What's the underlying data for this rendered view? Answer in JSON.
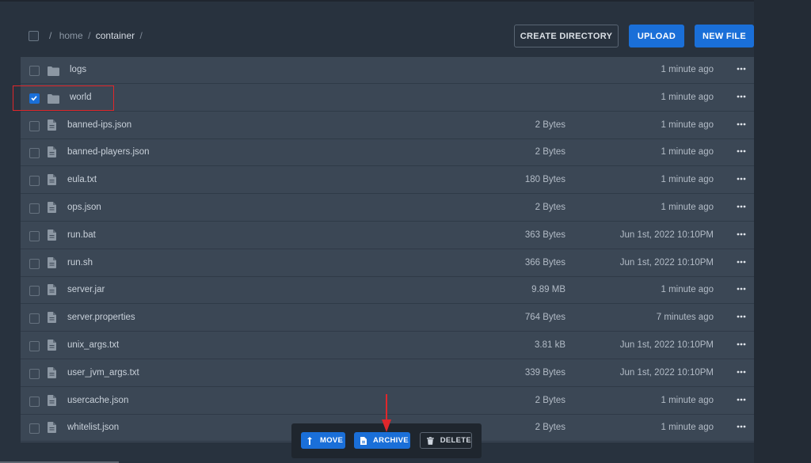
{
  "breadcrumb": {
    "root": "/",
    "home": "home",
    "sep1": "/",
    "current": "container",
    "sep2": "/"
  },
  "buttons": {
    "create_directory": "CREATE DIRECTORY",
    "upload": "UPLOAD",
    "new_file": "NEW FILE"
  },
  "files": [
    {
      "name": "logs",
      "type": "folder",
      "size": "",
      "modified": "1 minute ago",
      "checked": false
    },
    {
      "name": "world",
      "type": "folder",
      "size": "",
      "modified": "1 minute ago",
      "checked": true
    },
    {
      "name": "banned-ips.json",
      "type": "file",
      "size": "2 Bytes",
      "modified": "1 minute ago",
      "checked": false
    },
    {
      "name": "banned-players.json",
      "type": "file",
      "size": "2 Bytes",
      "modified": "1 minute ago",
      "checked": false
    },
    {
      "name": "eula.txt",
      "type": "file",
      "size": "180 Bytes",
      "modified": "1 minute ago",
      "checked": false
    },
    {
      "name": "ops.json",
      "type": "file",
      "size": "2 Bytes",
      "modified": "1 minute ago",
      "checked": false
    },
    {
      "name": "run.bat",
      "type": "file",
      "size": "363 Bytes",
      "modified": "Jun 1st, 2022 10:10PM",
      "checked": false
    },
    {
      "name": "run.sh",
      "type": "file",
      "size": "366 Bytes",
      "modified": "Jun 1st, 2022 10:10PM",
      "checked": false
    },
    {
      "name": "server.jar",
      "type": "file",
      "size": "9.89 MB",
      "modified": "1 minute ago",
      "checked": false
    },
    {
      "name": "server.properties",
      "type": "file",
      "size": "764 Bytes",
      "modified": "7 minutes ago",
      "checked": false
    },
    {
      "name": "unix_args.txt",
      "type": "file",
      "size": "3.81 kB",
      "modified": "Jun 1st, 2022 10:10PM",
      "checked": false
    },
    {
      "name": "user_jvm_args.txt",
      "type": "file",
      "size": "339 Bytes",
      "modified": "Jun 1st, 2022 10:10PM",
      "checked": false
    },
    {
      "name": "usercache.json",
      "type": "file",
      "size": "2 Bytes",
      "modified": "1 minute ago",
      "checked": false
    },
    {
      "name": "whitelist.json",
      "type": "file",
      "size": "2 Bytes",
      "modified": "1 minute ago",
      "checked": false
    }
  ],
  "actions": {
    "move": "MOVE",
    "archive": "ARCHIVE",
    "delete": "DELETE"
  },
  "colors": {
    "accent": "#1a6fd8",
    "highlight_box": "#e0272b",
    "row_bg": "#3b4755",
    "page_bg": "#28323e"
  }
}
